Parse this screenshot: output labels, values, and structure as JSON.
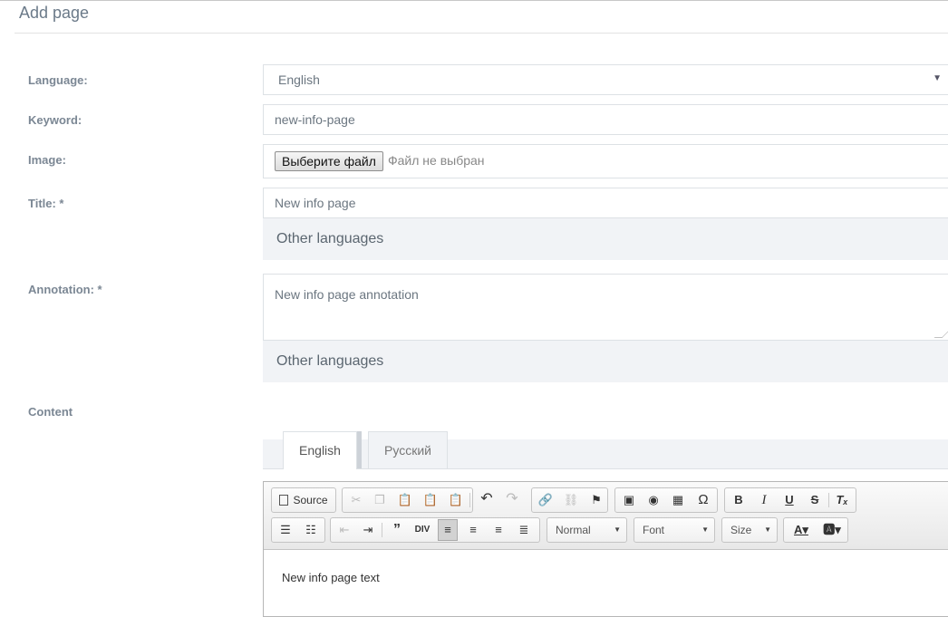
{
  "header": {
    "title": "Add page"
  },
  "form": {
    "language": {
      "label": "Language:",
      "value": "English"
    },
    "keyword": {
      "label": "Keyword:",
      "value": "new-info-page"
    },
    "image": {
      "label": "Image:",
      "button": "Выберите файл",
      "status": "Файл не выбран"
    },
    "title": {
      "label": "Title: *",
      "value": "New info page",
      "other_languages": "Other languages"
    },
    "annotation": {
      "label": "Annotation: *",
      "value": "New info page annotation",
      "other_languages": "Other languages"
    },
    "content": {
      "label": "Content"
    }
  },
  "tabs": [
    {
      "label": "English",
      "active": true
    },
    {
      "label": "Русский",
      "active": false
    }
  ],
  "editor": {
    "source_label": "Source",
    "format_combo": "Normal",
    "font_combo": "Font",
    "size_combo": "Size",
    "body_text": "New info page text",
    "toolbar_icons": [
      "source-icon",
      "cut-icon",
      "copy-icon",
      "paste-icon",
      "paste-text-icon",
      "paste-word-icon",
      "undo-icon",
      "redo-icon",
      "link-icon",
      "unlink-icon",
      "anchor-icon",
      "image-icon",
      "flash-icon",
      "table-icon",
      "special-char-icon",
      "bold-icon",
      "italic-icon",
      "underline-icon",
      "strike-icon",
      "remove-format-icon",
      "numbered-list-icon",
      "bulleted-list-icon",
      "outdent-icon",
      "indent-icon",
      "blockquote-icon",
      "div-icon",
      "align-left-icon",
      "align-center-icon",
      "align-right-icon",
      "justify-icon",
      "text-color-icon",
      "bg-color-icon"
    ]
  }
}
